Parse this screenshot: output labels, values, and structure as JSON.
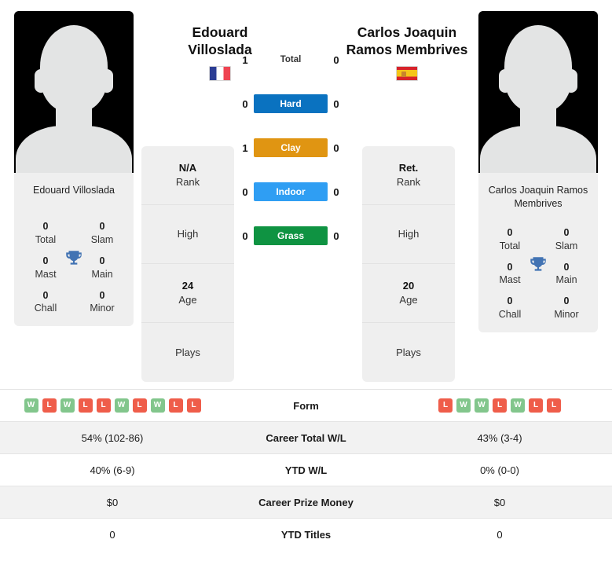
{
  "players": {
    "left": {
      "first_line": "Edouard",
      "second_line": "Villoslada",
      "full_name": "Edouard Villoslada",
      "flag": "fr",
      "rank_value": "N/A",
      "rank_label": "Rank",
      "high_value": "",
      "high_label": "High",
      "age_value": "24",
      "age_label": "Age",
      "plays_value": "",
      "plays_label": "Plays",
      "titles": {
        "total_value": "0",
        "total_label": "Total",
        "slam_value": "0",
        "slam_label": "Slam",
        "mast_value": "0",
        "mast_label": "Mast",
        "main_value": "0",
        "main_label": "Main",
        "chall_value": "0",
        "chall_label": "Chall",
        "minor_value": "0",
        "minor_label": "Minor"
      },
      "form": [
        "W",
        "L",
        "W",
        "L",
        "L",
        "W",
        "L",
        "W",
        "L",
        "L"
      ],
      "career_wl": "54% (102-86)",
      "ytd_wl": "40% (6-9)",
      "career_prize": "$0",
      "ytd_titles": "0"
    },
    "right": {
      "first_line": "Carlos Joaquin",
      "second_line": "Ramos Membrives",
      "full_name": "Carlos Joaquin Ramos Membrives",
      "flag": "es",
      "rank_value": "Ret.",
      "rank_label": "Rank",
      "high_value": "",
      "high_label": "High",
      "age_value": "20",
      "age_label": "Age",
      "plays_value": "",
      "plays_label": "Plays",
      "titles": {
        "total_value": "0",
        "total_label": "Total",
        "slam_value": "0",
        "slam_label": "Slam",
        "mast_value": "0",
        "mast_label": "Mast",
        "main_value": "0",
        "main_label": "Main",
        "chall_value": "0",
        "chall_label": "Chall",
        "minor_value": "0",
        "minor_label": "Minor"
      },
      "form": [
        "L",
        "W",
        "W",
        "L",
        "W",
        "L",
        "L"
      ],
      "career_wl": "43% (3-4)",
      "ytd_wl": "0% (0-0)",
      "career_prize": "$0",
      "ytd_titles": "0"
    }
  },
  "h2h": {
    "rows": [
      {
        "label": "Total",
        "left": "1",
        "right": "0",
        "color": "transparent"
      },
      {
        "label": "Hard",
        "left": "0",
        "right": "0",
        "color": "#0a72c0"
      },
      {
        "label": "Clay",
        "left": "1",
        "right": "0",
        "color": "#e09512"
      },
      {
        "label": "Indoor",
        "left": "0",
        "right": "0",
        "color": "#2f9ef3"
      },
      {
        "label": "Grass",
        "left": "0",
        "right": "0",
        "color": "#0f9342"
      }
    ]
  },
  "comparison": {
    "rows": [
      {
        "label": "Form",
        "key": "form"
      },
      {
        "label": "Career Total W/L",
        "key": "career_wl"
      },
      {
        "label": "YTD W/L",
        "key": "ytd_wl"
      },
      {
        "label": "Career Prize Money",
        "key": "career_prize"
      },
      {
        "label": "YTD Titles",
        "key": "ytd_titles"
      }
    ]
  },
  "colors": {
    "hard": "#0a72c0",
    "clay": "#e09512",
    "indoor": "#2f9ef3",
    "grass": "#0f9342",
    "win": "#82c68c",
    "loss": "#ef5d4a",
    "trophy": "#4273b3",
    "card_bg": "#efefef"
  }
}
